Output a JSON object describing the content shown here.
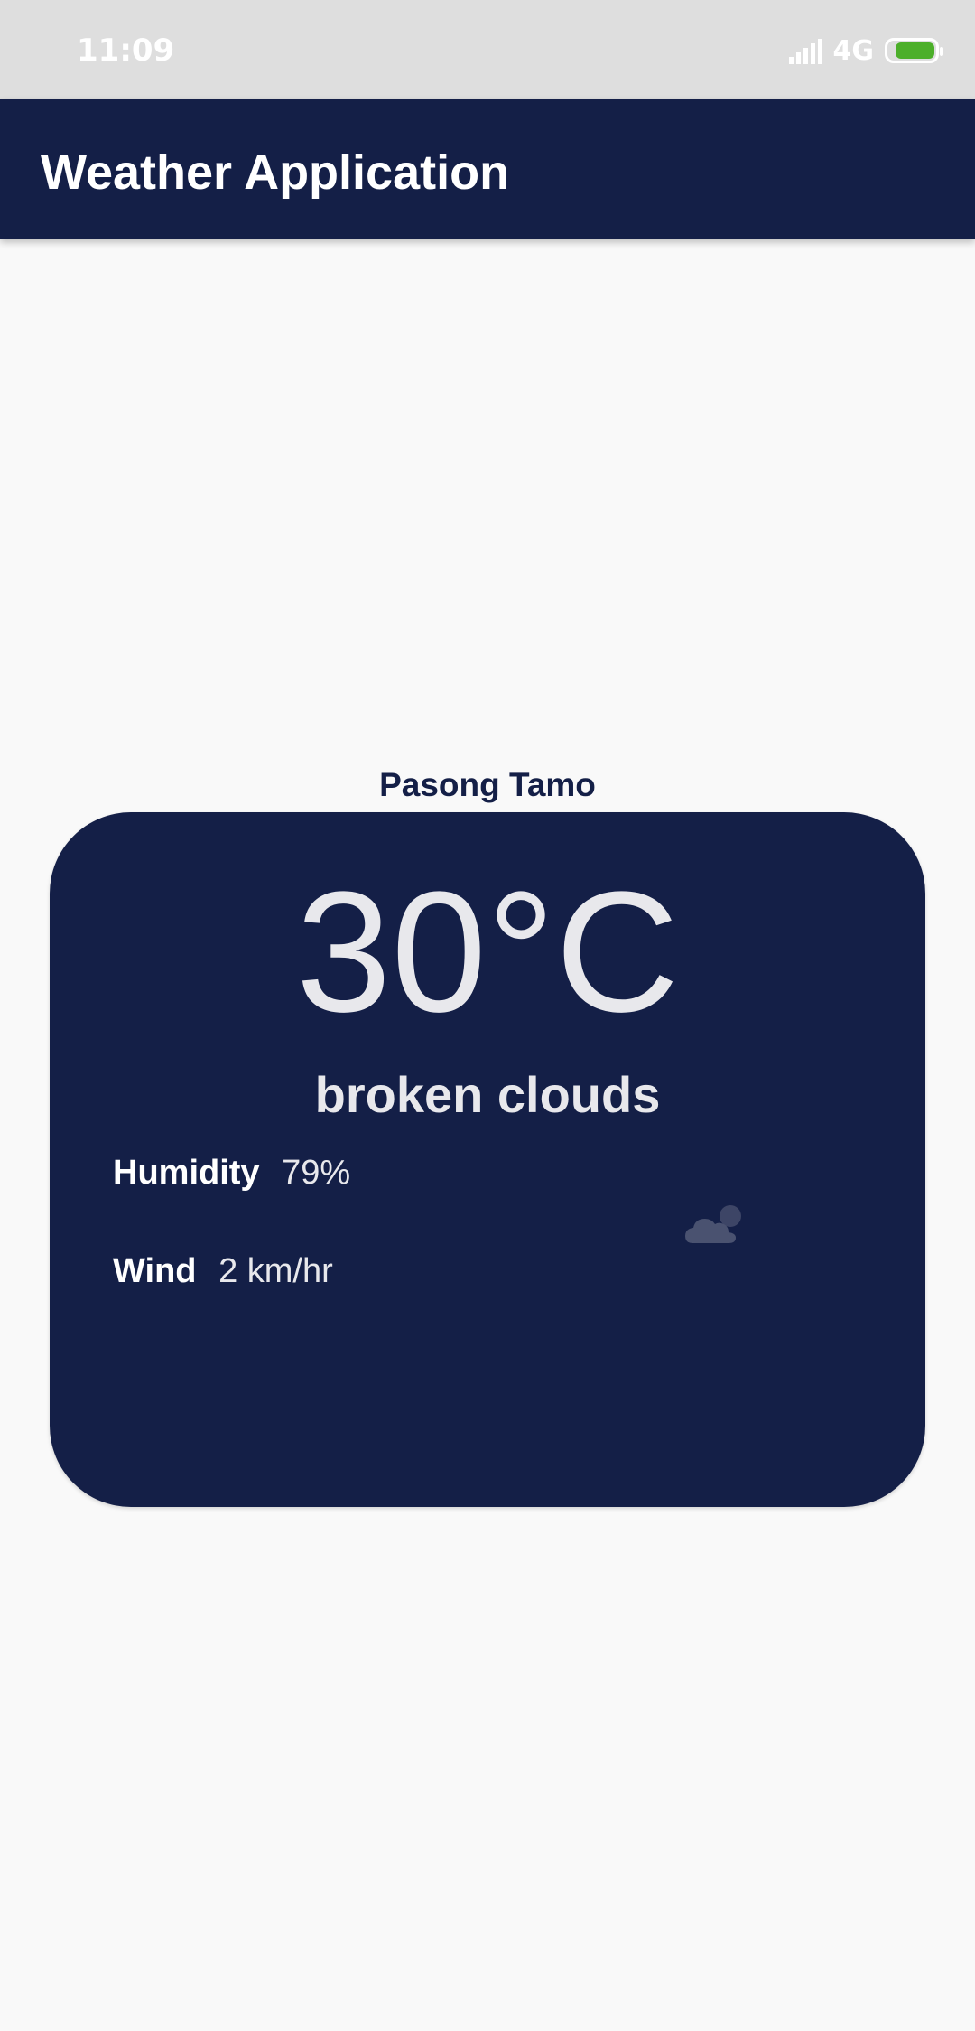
{
  "status_bar": {
    "time": "11:09",
    "network": "4G",
    "battery_level": 0.85,
    "battery_color": "#4caf2a",
    "signal_icon": "signal-icon",
    "battery_icon": "battery-charging-icon"
  },
  "app_bar": {
    "title": "Weather Application",
    "background": "#141f47"
  },
  "weather": {
    "location": "Pasong Tamo",
    "temperature": "30°C",
    "description": "broken clouds",
    "humidity_label": "Humidity",
    "humidity_value": "79%",
    "wind_label": "Wind",
    "wind_value": "2 km/hr",
    "icon": "broken-clouds-icon",
    "card_color": "#141f47"
  }
}
